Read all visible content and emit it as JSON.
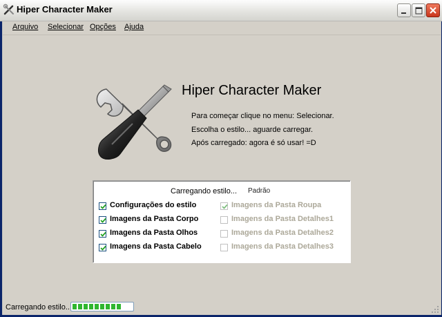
{
  "window": {
    "title": "Hiper Character Maker",
    "controls": [
      "minimize-icon",
      "maximize-icon",
      "close-icon"
    ]
  },
  "menu": {
    "items": [
      "Arquivo",
      "Selecionar",
      "Opções",
      "Ajuda"
    ]
  },
  "main": {
    "heading": "Hiper Character Maker",
    "icon": "tools-icon",
    "instructions": [
      "Para começar clique no menu: Selecionar.",
      "Escolha o estilo... aguarde carregar.",
      "Após carregado: agora é só usar! =D"
    ]
  },
  "panel": {
    "status": "Carregando estilo...",
    "style_name": "Padrão",
    "items": [
      {
        "label": "Configurações do estilo",
        "checked": true,
        "enabled": true
      },
      {
        "label": "Imagens da Pasta Corpo",
        "checked": true,
        "enabled": true
      },
      {
        "label": "Imagens da Pasta Olhos",
        "checked": true,
        "enabled": true
      },
      {
        "label": "Imagens da Pasta Cabelo",
        "checked": true,
        "enabled": true
      },
      {
        "label": "Imagens da Pasta Roupa",
        "checked": true,
        "enabled": false
      },
      {
        "label": "Imagens da Pasta Detalhes1",
        "checked": false,
        "enabled": false
      },
      {
        "label": "Imagens da Pasta Detalhes2",
        "checked": false,
        "enabled": false
      },
      {
        "label": "Imagens da Pasta Detalhes3",
        "checked": false,
        "enabled": false
      }
    ]
  },
  "statusbar": {
    "text": "Carregando estilo...",
    "progress": 0.8,
    "progress_color": "#2fb62f"
  }
}
